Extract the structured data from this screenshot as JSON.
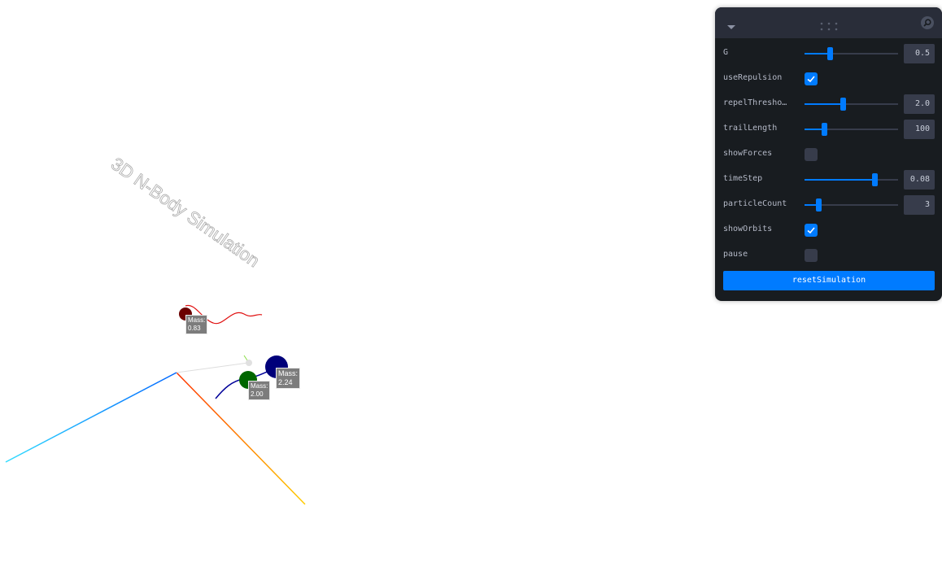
{
  "scene": {
    "title": "3D N-Body Simulation",
    "bodies": [
      {
        "name": "red-body",
        "color": "#6b0000",
        "trail_color": "#e01010",
        "mass_label": "Mass:",
        "mass_value": "0.83"
      },
      {
        "name": "green-body",
        "color": "#006600",
        "trail_color": "#000099",
        "mass_label": "Mass:",
        "mass_value": "2.00"
      },
      {
        "name": "blue-body",
        "color": "#00007a",
        "trail_color": "#000099",
        "mass_label": "Mass:",
        "mass_value": "2.24"
      }
    ],
    "axis_colors": {
      "x": "#ffa500",
      "y": "#aaff00",
      "z": "#00bfff"
    }
  },
  "panel": {
    "controls": [
      {
        "label": "G",
        "type": "slider",
        "value": "0.5",
        "fraction": 0.27
      },
      {
        "label": "useRepulsion",
        "type": "checkbox",
        "checked": true
      },
      {
        "label": "repelThresho…",
        "type": "slider",
        "value": "2.0",
        "fraction": 0.41
      },
      {
        "label": "trailLength",
        "type": "slider",
        "value": "100",
        "fraction": 0.21
      },
      {
        "label": "showForces",
        "type": "checkbox",
        "checked": false
      },
      {
        "label": "timeStep",
        "type": "slider",
        "value": "0.08",
        "fraction": 0.75
      },
      {
        "label": "particleCount",
        "type": "slider",
        "value": "3",
        "fraction": 0.15
      },
      {
        "label": "showOrbits",
        "type": "checkbox",
        "checked": true
      },
      {
        "label": "pause",
        "type": "checkbox",
        "checked": false
      }
    ],
    "reset_label": "resetSimulation",
    "accent": "#007bff"
  }
}
